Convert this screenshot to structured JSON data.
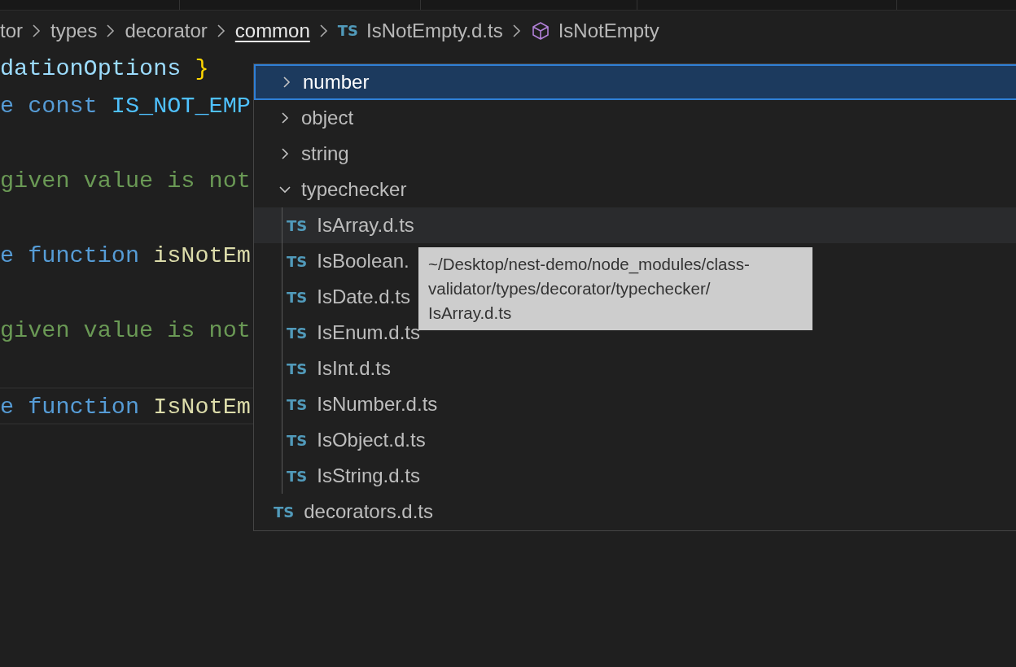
{
  "breadcrumb": [
    {
      "label": "tor",
      "kind": "folder",
      "focused": false
    },
    {
      "label": "types",
      "kind": "folder",
      "focused": false
    },
    {
      "label": "decorator",
      "kind": "folder",
      "focused": false
    },
    {
      "label": "common",
      "kind": "folder",
      "focused": true
    },
    {
      "label": "IsNotEmpty.d.ts",
      "kind": "file",
      "badge": "TS",
      "focused": false
    },
    {
      "label": "IsNotEmpty",
      "kind": "symbol",
      "focused": false
    }
  ],
  "code": [
    {
      "kind": "code",
      "current": false,
      "tokens": [
        {
          "kind": "variable",
          "text": "dationOptions "
        },
        {
          "kind": "brace",
          "text": "}"
        }
      ]
    },
    {
      "kind": "code",
      "current": false,
      "tokens": [
        {
          "kind": "keyword",
          "text": "e const "
        },
        {
          "kind": "constant",
          "text": "IS_NOT_EMP"
        }
      ]
    },
    {
      "kind": "blank"
    },
    {
      "kind": "code",
      "current": false,
      "tokens": [
        {
          "kind": "comment",
          "text": "given value is not"
        }
      ]
    },
    {
      "kind": "blank"
    },
    {
      "kind": "code",
      "current": false,
      "tokens": [
        {
          "kind": "keyword",
          "text": "e function "
        },
        {
          "kind": "function",
          "text": "isNotEm"
        }
      ]
    },
    {
      "kind": "blank"
    },
    {
      "kind": "code",
      "current": false,
      "tokens": [
        {
          "kind": "comment",
          "text": "given value is not"
        }
      ]
    },
    {
      "kind": "blank"
    },
    {
      "kind": "code",
      "current": true,
      "tokens": [
        {
          "kind": "keyword",
          "text": "e function "
        },
        {
          "kind": "function",
          "text": "IsNotEm"
        }
      ]
    }
  ],
  "tree": [
    {
      "kind": "folder",
      "label": "number",
      "expanded": false,
      "selected": true,
      "hovered": false
    },
    {
      "kind": "folder",
      "label": "object",
      "expanded": false,
      "selected": false,
      "hovered": false
    },
    {
      "kind": "folder",
      "label": "string",
      "expanded": false,
      "selected": false,
      "hovered": false
    },
    {
      "kind": "folder",
      "label": "typechecker",
      "expanded": true,
      "selected": false,
      "hovered": false,
      "children": [
        {
          "kind": "file",
          "badge": "TS",
          "label": "IsArray.d.ts",
          "selected": false,
          "hovered": true
        },
        {
          "kind": "file",
          "badge": "TS",
          "label": "IsBoolean.",
          "selected": false,
          "hovered": false
        },
        {
          "kind": "file",
          "badge": "TS",
          "label": "IsDate.d.ts",
          "selected": false,
          "hovered": false
        },
        {
          "kind": "file",
          "badge": "TS",
          "label": "IsEnum.d.ts",
          "selected": false,
          "hovered": false
        },
        {
          "kind": "file",
          "badge": "TS",
          "label": "IsInt.d.ts",
          "selected": false,
          "hovered": false
        },
        {
          "kind": "file",
          "badge": "TS",
          "label": "IsNumber.d.ts",
          "selected": false,
          "hovered": false
        },
        {
          "kind": "file",
          "badge": "TS",
          "label": "IsObject.d.ts",
          "selected": false,
          "hovered": false
        },
        {
          "kind": "file",
          "badge": "TS",
          "label": "IsString.d.ts",
          "selected": false,
          "hovered": false
        }
      ]
    },
    {
      "kind": "file",
      "badge": "TS",
      "label": "decorators.d.ts",
      "selected": false,
      "hovered": false
    }
  ],
  "tooltip": {
    "lines": [
      "~/Desktop/nest-demo/node_modules/class-",
      "validator/types/decorator/typechecker/",
      "IsArray.d.ts"
    ]
  }
}
